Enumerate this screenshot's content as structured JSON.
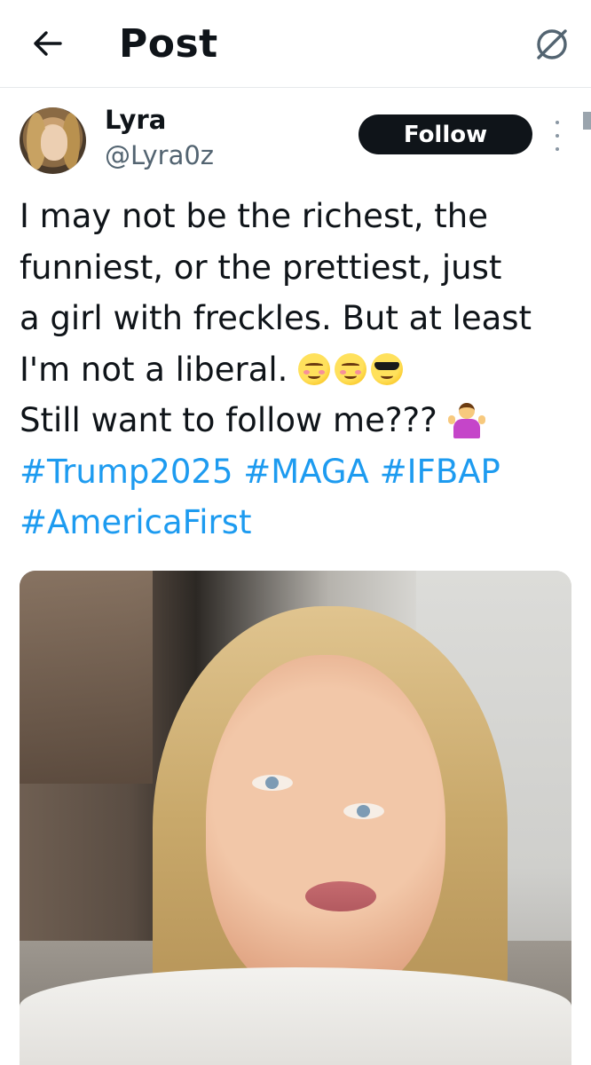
{
  "header": {
    "title": "Post"
  },
  "author": {
    "name": "Lyra",
    "handle": "@Lyra0z",
    "follow_label": "Follow"
  },
  "post": {
    "lines": [
      "I may not be the richest, the",
      "funniest, or the prettiest, just",
      "a girl with freckles. But at least",
      "I'm not a liberal.",
      "Still want to follow me???"
    ],
    "hashtags": [
      "#Trump2025",
      "#MAGA",
      "#IFBAP",
      "#AmericaFirst"
    ],
    "emojis": [
      "blush-emoji",
      "relieved-emoji",
      "sunglasses-emoji",
      "person-shrugging-emoji"
    ]
  },
  "colors": {
    "text": "#0f1419",
    "secondary": "#536471",
    "accent": "#1d9bf0",
    "follow_bg": "#0f1419"
  },
  "icons": {
    "back": "arrow-left-icon",
    "grok": "grok-icon",
    "more": "more-vertical-icon"
  }
}
